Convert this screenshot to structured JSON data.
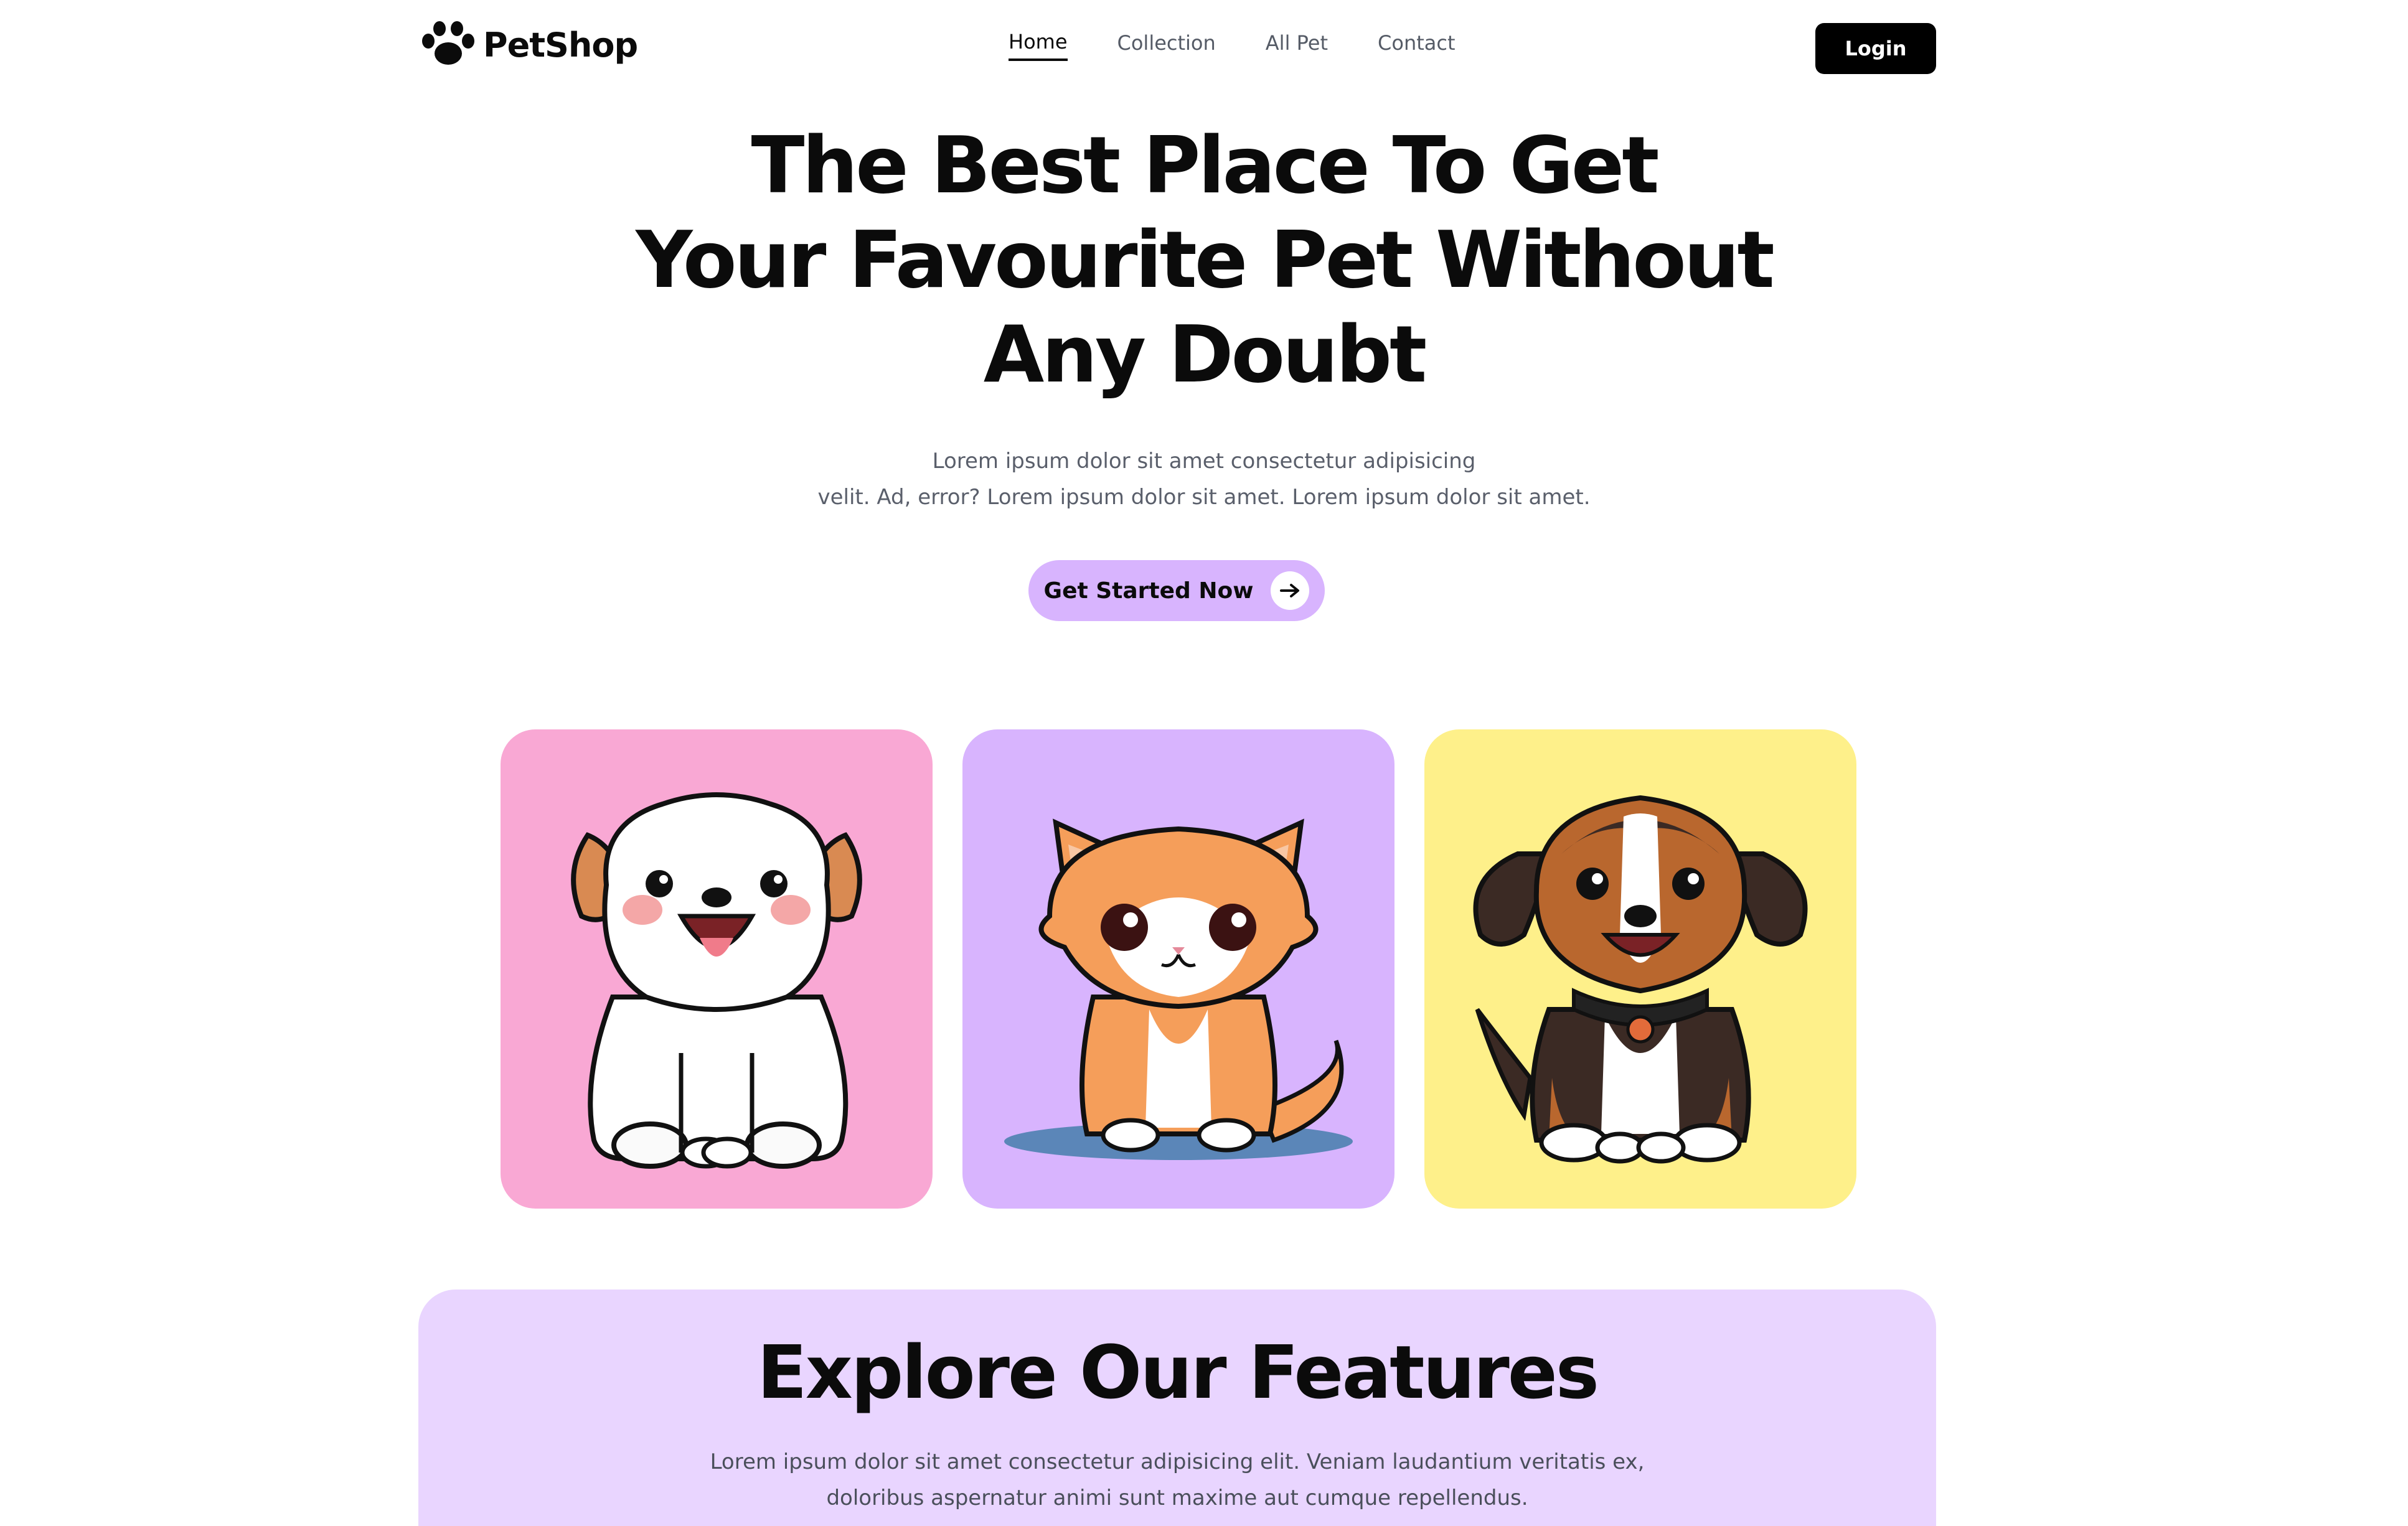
{
  "header": {
    "logo_text": "PetShop",
    "logo_icon": "paw-icon",
    "nav": [
      {
        "label": "Home",
        "active": true
      },
      {
        "label": "Collection",
        "active": false
      },
      {
        "label": "All Pet",
        "active": false
      },
      {
        "label": "Contact",
        "active": false
      }
    ],
    "login_label": "Login"
  },
  "hero": {
    "title_lines": [
      "The Best Place To Get",
      "Your Favourite Pet Without",
      "Any Doubt"
    ],
    "subtitle_lines": [
      "Lorem ipsum dolor sit amet consectetur adipisicing",
      "velit. Ad, error? Lorem ipsum dolor sit amet. Lorem ipsum dolor sit amet."
    ],
    "cta_label": "Get Started Now",
    "cta_icon": "arrow-right-icon"
  },
  "cards": [
    {
      "pet": "white-puppy-illustration",
      "background": "#f9a8d4"
    },
    {
      "pet": "orange-kitten-illustration",
      "background": "#d8b4fe"
    },
    {
      "pet": "brown-puppy-illustration",
      "background": "#fef08a"
    }
  ],
  "features": {
    "title": "Explore Our Features",
    "subtitle_lines": [
      "Lorem ipsum dolor sit amet consectetur adipisicing elit. Veniam laudantium veritatis ex,",
      "doloribus aspernatur animi sunt maxime aut cumque repellendus."
    ],
    "background": "#e9d5ff"
  },
  "colors": {
    "accent": "#d8b4fe",
    "primary_text": "#0b0b0b",
    "muted_text": "#5a5f6b",
    "button_dark": "#000000"
  }
}
